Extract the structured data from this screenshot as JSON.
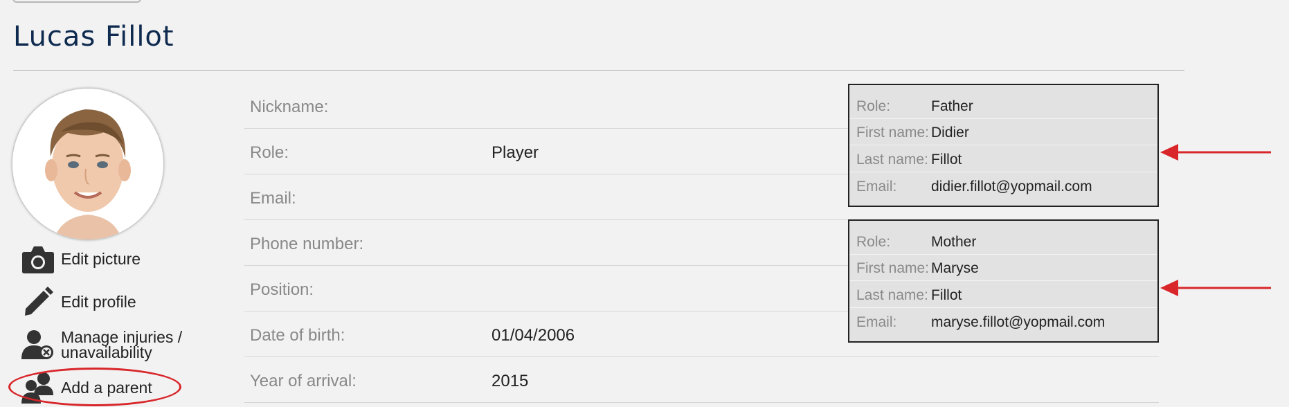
{
  "profile": {
    "name": "Lucas Fillot"
  },
  "actions": [
    {
      "label": "Edit picture",
      "icon": "camera-icon"
    },
    {
      "label": "Edit profile",
      "icon": "pencil-icon"
    },
    {
      "label": "Manage injuries /\nunavailability",
      "icon": "user-unavailable-icon"
    },
    {
      "label": "Add a parent",
      "icon": "add-parent-icon"
    }
  ],
  "fields": [
    {
      "label": "Nickname:",
      "value": ""
    },
    {
      "label": "Role:",
      "value": "Player"
    },
    {
      "label": "Email:",
      "value": ""
    },
    {
      "label": "Phone number:",
      "value": ""
    },
    {
      "label": "Position:",
      "value": ""
    },
    {
      "label": "Date of birth:",
      "value": "01/04/2006"
    },
    {
      "label": "Year of arrival:",
      "value": "2015"
    }
  ],
  "parents": [
    {
      "role_label": "Role:",
      "role": "Father",
      "first_name_label": "First name:",
      "first_name": "Didier",
      "last_name_label": "Last name:",
      "last_name": "Fillot",
      "email_label": "Email:",
      "email": "didier.fillot@yopmail.com"
    },
    {
      "role_label": "Role:",
      "role": "Mother",
      "first_name_label": "First name:",
      "first_name": "Maryse",
      "last_name_label": "Last name:",
      "last_name": "Fillot",
      "email_label": "Email:",
      "email": "maryse.fillot@yopmail.com"
    }
  ],
  "colors": {
    "title": "#0e2a4f",
    "annotation": "#d8262a",
    "icon": "#333333"
  }
}
